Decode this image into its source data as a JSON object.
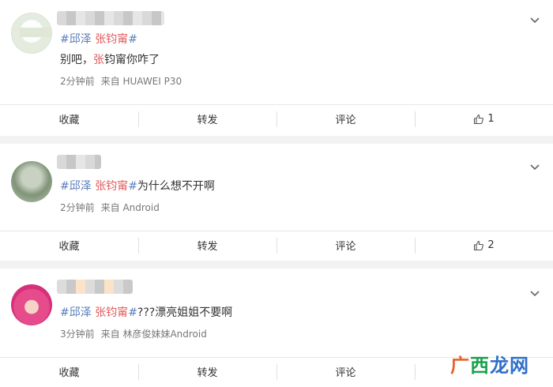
{
  "posts": [
    {
      "topic1": "#邱泽",
      "name": "张钧甯",
      "topic_end": "#",
      "text_prefix": "别吧，",
      "text_name": "张",
      "text_suffix": "钧甯你咋了",
      "time": "2分钟前",
      "source": "来自 HUAWEI P30",
      "actions": {
        "favorite": "收藏",
        "repost": "转发",
        "comment": "评论",
        "likes": "1"
      }
    },
    {
      "topic1": "#邱泽",
      "name": "张钧甯",
      "topic_end": "#",
      "text": "为什么想不开啊",
      "time": "2分钟前",
      "source": "来自 Android",
      "actions": {
        "favorite": "收藏",
        "repost": "转发",
        "comment": "评论",
        "likes": "2"
      }
    },
    {
      "topic1": "#邱泽",
      "name": "张钧甯",
      "topic_end": "#",
      "text": "???漂亮姐姐不要啊",
      "time": "3分钟前",
      "source": "来自 林彦俊妹妹Android",
      "actions": {
        "favorite": "收藏",
        "repost": "转发",
        "comment": "评论"
      }
    }
  ],
  "watermark": {
    "part1": "广",
    "part2": "西",
    "part3": "龙网"
  },
  "colors": {
    "topic": "#5a7fbd",
    "name_highlight": "#e05a5a",
    "watermark_orange": "#e8622a"
  }
}
